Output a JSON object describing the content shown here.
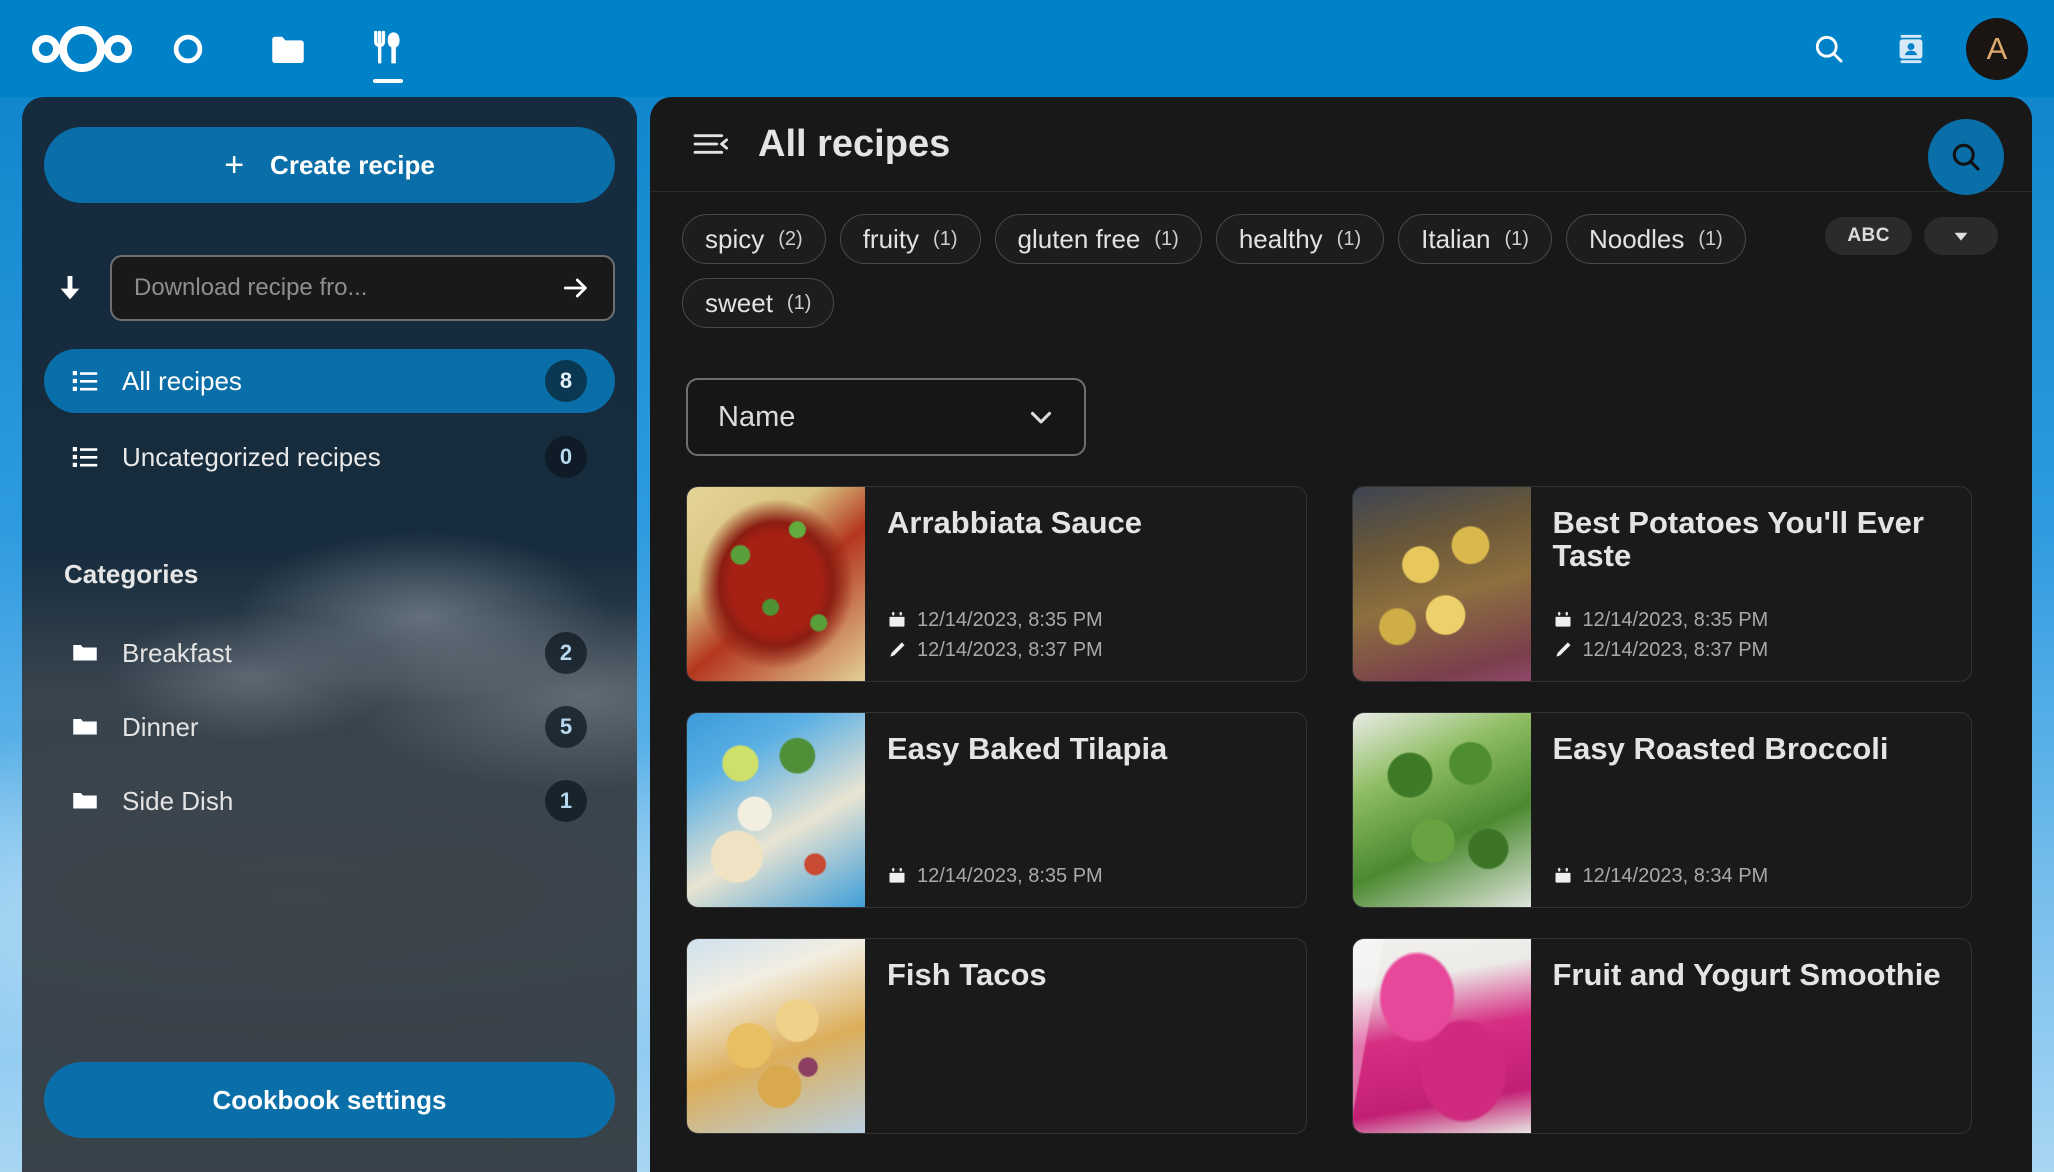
{
  "topbar": {
    "logo_name": "nextcloud-logo",
    "apps": [
      {
        "name": "dashboard-icon",
        "label": "Dashboard",
        "active": false
      },
      {
        "name": "files-icon",
        "label": "Files",
        "active": false
      },
      {
        "name": "cookbook-icon",
        "label": "Cookbook",
        "active": true
      }
    ],
    "search_label": "Search",
    "contacts_label": "Contacts",
    "avatar_initial": "A"
  },
  "sidebar": {
    "create_button": "Create recipe",
    "create_icon": "plus-icon",
    "download": {
      "icon": "download-arrow-icon",
      "placeholder": "Download recipe fro...",
      "value": "",
      "submit_icon": "arrow-right-icon"
    },
    "nav": [
      {
        "label": "All recipes",
        "count": "8",
        "icon": "list-icon",
        "active": true
      },
      {
        "label": "Uncategorized recipes",
        "count": "0",
        "icon": "list-icon",
        "active": false
      }
    ],
    "categories_title": "Categories",
    "categories": [
      {
        "label": "Breakfast",
        "count": "2",
        "icon": "folder-icon"
      },
      {
        "label": "Dinner",
        "count": "5",
        "icon": "folder-icon"
      },
      {
        "label": "Side Dish",
        "count": "1",
        "icon": "folder-icon"
      }
    ],
    "settings_button": "Cookbook settings"
  },
  "main": {
    "menu_icon": "collapse-menu-icon",
    "title": "All recipes",
    "fab_search_icon": "search-icon",
    "tags": [
      {
        "label": "spicy",
        "count": "(2)"
      },
      {
        "label": "fruity",
        "count": "(1)"
      },
      {
        "label": "gluten free",
        "count": "(1)"
      },
      {
        "label": "healthy",
        "count": "(1)"
      },
      {
        "label": "Italian",
        "count": "(1)"
      },
      {
        "label": "Noodles",
        "count": "(1)"
      },
      {
        "label": "sweet",
        "count": "(1)"
      }
    ],
    "sort": {
      "abc_label": "ABC",
      "direction_icon": "chevron-down-icon",
      "select_value": "Name",
      "select_icon": "chevron-down-icon"
    },
    "recipes": [
      {
        "title": "Arrabbiata Sauce",
        "image": "img-arrabbiata",
        "created": "12/14/2023, 8:35 PM",
        "modified": "12/14/2023, 8:37 PM"
      },
      {
        "title": "Best Potatoes You'll Ever Taste",
        "image": "img-potatoes",
        "created": "12/14/2023, 8:35 PM",
        "modified": "12/14/2023, 8:37 PM"
      },
      {
        "title": "Easy Baked Tilapia",
        "image": "img-tilapia",
        "created": "12/14/2023, 8:35 PM",
        "modified": ""
      },
      {
        "title": "Easy Roasted Broccoli",
        "image": "img-broccoli",
        "created": "12/14/2023, 8:34 PM",
        "modified": ""
      },
      {
        "title": "Fish Tacos",
        "image": "img-tacos",
        "created": "",
        "modified": ""
      },
      {
        "title": "Fruit and Yogurt Smoothie",
        "image": "img-smoothie",
        "created": "",
        "modified": ""
      }
    ]
  },
  "colors": {
    "brand_blue": "#0082c9",
    "button_blue": "#0a6fa8",
    "content_bg": "#181818",
    "card_bg": "#1a1a1a",
    "sidebar_bg": "#162838"
  }
}
